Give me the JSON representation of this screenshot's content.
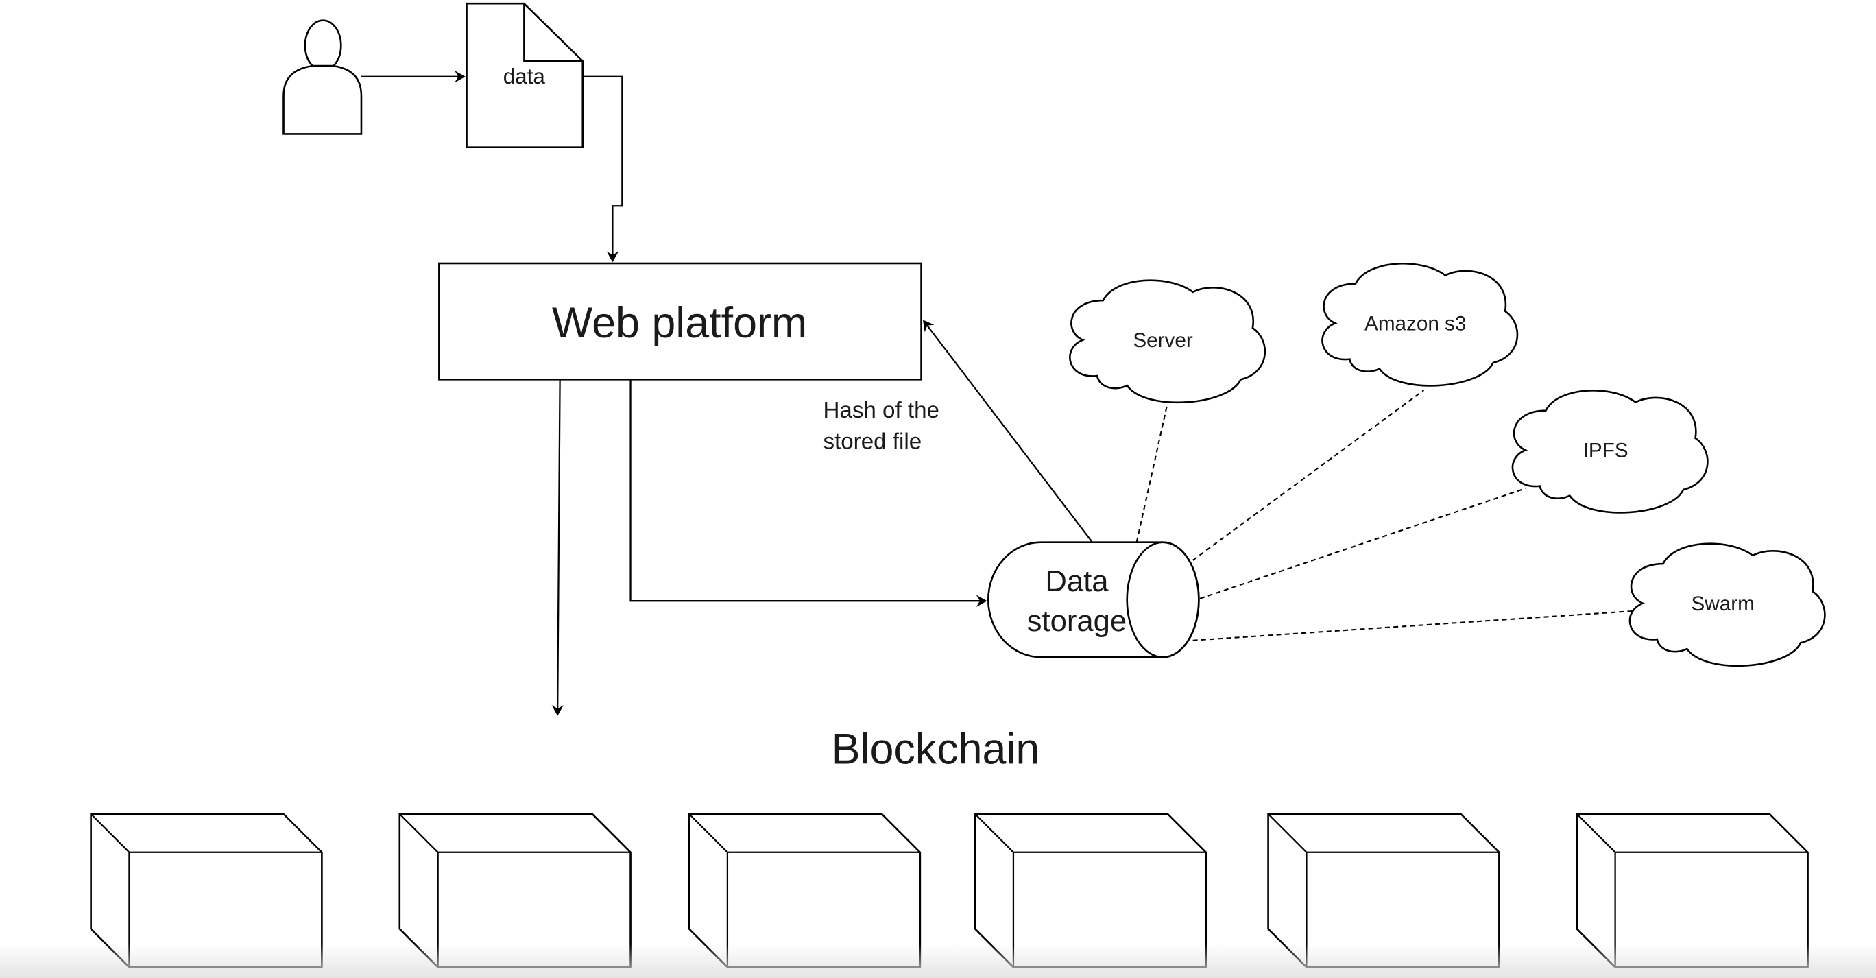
{
  "diagram": {
    "nodes": {
      "user": {
        "label": "",
        "icon": "user-icon"
      },
      "data_doc": {
        "label": "data",
        "icon": "document-icon"
      },
      "web_platform": {
        "label": "Web platform"
      },
      "data_storage": {
        "label_line1": "Data",
        "label_line2": "storage",
        "icon": "cylinder-storage-icon"
      },
      "clouds": [
        {
          "label": "Server"
        },
        {
          "label": "Amazon s3"
        },
        {
          "label": "IPFS"
        },
        {
          "label": "Swarm"
        }
      ],
      "blockchain": {
        "title": "Blockchain",
        "block_count": 6
      }
    },
    "edges": {
      "hash_label_line1": "Hash of the",
      "hash_label_line2": "stored file"
    }
  }
}
